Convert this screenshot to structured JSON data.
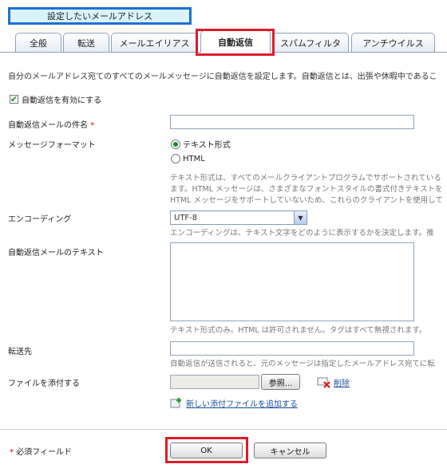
{
  "header": {
    "address_label": "設定したいメールアドレス"
  },
  "tabs": [
    {
      "label": "全般"
    },
    {
      "label": "転送"
    },
    {
      "label": "メールエイリアス"
    },
    {
      "label": "自動返信"
    },
    {
      "label": "スパムフィルタ"
    },
    {
      "label": "アンチウイルス"
    }
  ],
  "intro": "自分のメールアドレス宛てのすべてのメールメッセージに自動返信を設定します。自動返信とは、出張や休暇中であるこ",
  "enable_checkbox": {
    "label": "自動返信を有効にする",
    "checked": true
  },
  "subject": {
    "label": "自動返信メールの件名",
    "required_mark": "*",
    "value": ""
  },
  "format": {
    "label": "メッセージフォーマット",
    "options": [
      {
        "label": "テキスト形式",
        "selected": true
      },
      {
        "label": "HTML",
        "selected": false
      }
    ],
    "help": [
      "テキスト形式は、すべてのメールクライアントプログラムでサポートされている",
      "ます。HTML メッセージは、さまざまなフォントスタイルの書式付きテキストを",
      "HTML メッセージをサポートしていないため、これらのクライアントを使用して"
    ]
  },
  "encoding": {
    "label": "エンコーディング",
    "selected": "UTF-8",
    "help": "エンコーディングは、テキスト文字をどのように表示するかを決定します。推"
  },
  "reply_text": {
    "label": "自動返信メールのテキスト",
    "help": "テキスト形式のみ。HTML は許可されません。タグはすべて無視されます。"
  },
  "forward": {
    "label": "転送先",
    "help": "自動返信が送信されると、元のメッセージは指定したメールアドレス宛てに転"
  },
  "attach": {
    "label": "ファイルを添付する",
    "browse_label": "参照...",
    "delete_label": "削除",
    "add_link": "新しい添付ファイルを追加する"
  },
  "footer": {
    "required_mark": "*",
    "required_label": "必須フィールド",
    "ok_label": "OK",
    "cancel_label": "キャンセル"
  },
  "colors": {
    "highlight_red": "#e01b2a",
    "highlight_blue": "#1e6fd4"
  }
}
